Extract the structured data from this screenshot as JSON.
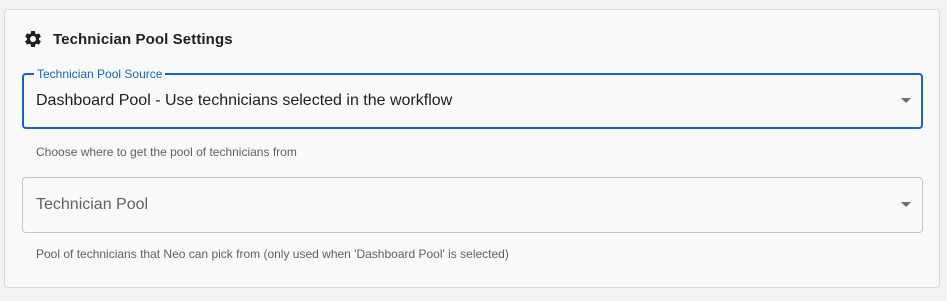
{
  "section": {
    "icon": "gear-icon",
    "title": "Technician Pool Settings"
  },
  "source_field": {
    "label": "Technician Pool Source",
    "value": "Dashboard Pool - Use technicians selected in the workflow",
    "helper": "Choose where to get the pool of technicians from"
  },
  "pool_field": {
    "placeholder": "Technician Pool",
    "helper": "Pool of technicians that Neo can pick from (only used when 'Dashboard Pool' is selected)"
  },
  "colors": {
    "accent": "#1565c0",
    "border": "#c4c4c4",
    "panel_bg": "#f9f9f8"
  }
}
